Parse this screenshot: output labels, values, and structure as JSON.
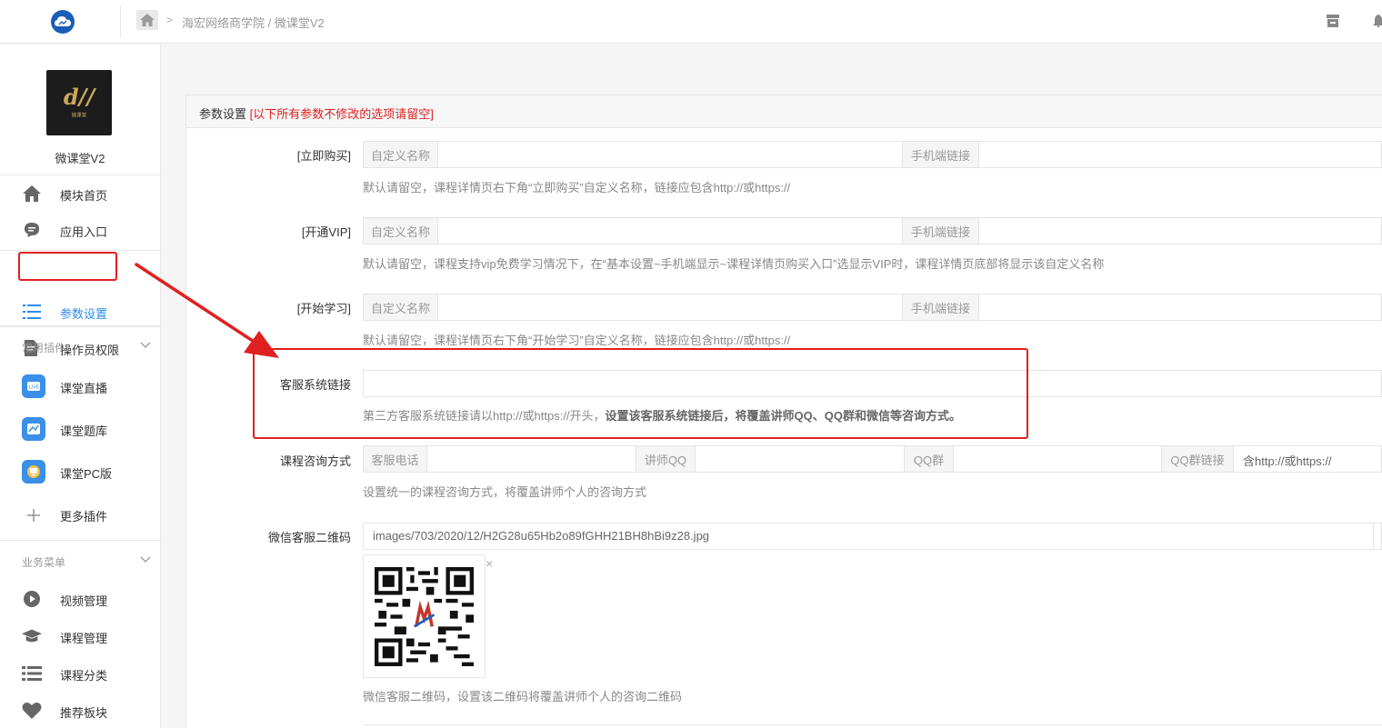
{
  "header": {
    "breadcrumb_sep": ">",
    "breadcrumb": "海宏网络商学院 / 微课堂V2"
  },
  "sidebar": {
    "app_name": "微课堂V2",
    "app_logo_mark": "d//",
    "app_logo_sub": "微课堂",
    "items": [
      {
        "label": "模块首页"
      },
      {
        "label": "应用入口"
      },
      {
        "label": "参数设置"
      },
      {
        "label": "操作员权限"
      }
    ],
    "group_plugins": "常用插件",
    "plugins": [
      {
        "label": "课堂直播"
      },
      {
        "label": "课堂题库"
      },
      {
        "label": "课堂PC版"
      },
      {
        "label": "更多插件"
      }
    ],
    "group_business": "业务菜单",
    "business": [
      {
        "label": "视频管理"
      },
      {
        "label": "课程管理"
      },
      {
        "label": "课程分类"
      },
      {
        "label": "推荐板块"
      }
    ]
  },
  "panel": {
    "title": "参数设置",
    "title_warn": "[以下所有参数不修改的选项请留空]",
    "rows": {
      "buy_now": {
        "label": "[立即购买]",
        "addon_name": "自定义名称",
        "addon_link": "手机端链接",
        "help": "默认请留空，课程详情页右下角“立即购买”自定义名称，链接应包含http://或https://"
      },
      "vip": {
        "label": "[开通VIP]",
        "addon_name": "自定义名称",
        "addon_link": "手机端链接",
        "help": "默认请留空，课程支持vip免费学习情况下，在“基本设置~手机端显示~课程详情页购买入口”选显示VIP时，课程详情页底部将显示该自定义名称"
      },
      "start": {
        "label": "[开始学习]",
        "addon_name": "自定义名称",
        "addon_link": "手机端链接",
        "help": "默认请留空，课程详情页右下角“开始学习”自定义名称，链接应包含http://或https://"
      },
      "cs_link": {
        "label": "客服系统链接",
        "help_plain": "第三方客服系统链接请以http://或https://开头，",
        "help_bold": "设置该客服系统链接后，将覆盖讲师QQ、QQ群和微信等咨询方式。"
      },
      "consult": {
        "label": "课程咨询方式",
        "addon_phone": "客服电话",
        "addon_qq": "讲师QQ",
        "addon_group": "QQ群",
        "addon_group_link": "QQ群链接",
        "group_link_placeholder": "含http://或https://",
        "help": "设置统一的课程咨询方式，将覆盖讲师个人的咨询方式"
      },
      "wechat_qr": {
        "label": "微信客服二维码",
        "value": "images/703/2020/12/H2G28u65Hb2o89fGHH21BH8hBi9z28.jpg",
        "close": "×",
        "help": "微信客服二维码，设置该二维码将覆盖讲师个人的咨询二维码"
      }
    }
  },
  "colors": {
    "accent": "#2d8cf0",
    "annotation": "#e02020",
    "brand": "#1a5db8"
  }
}
